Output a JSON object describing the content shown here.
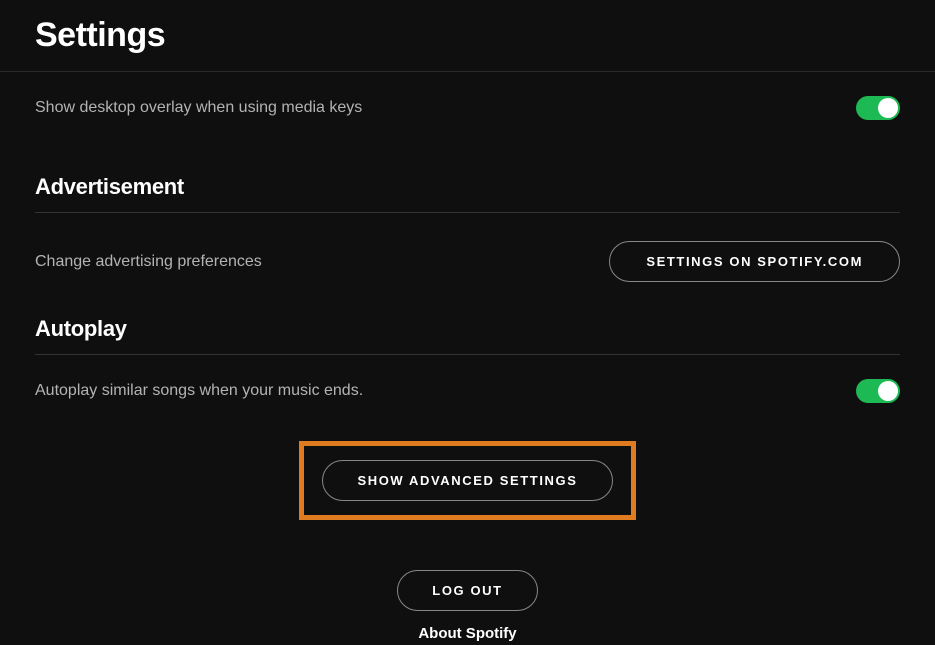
{
  "header": {
    "title": "Settings"
  },
  "overlay": {
    "label": "Show desktop overlay when using media keys",
    "toggled": true
  },
  "advertisement": {
    "heading": "Advertisement",
    "label": "Change advertising preferences",
    "button": "SETTINGS ON SPOTIFY.COM"
  },
  "autoplay": {
    "heading": "Autoplay",
    "label": "Autoplay similar songs when your music ends.",
    "toggled": true
  },
  "buttons": {
    "advanced": "SHOW ADVANCED SETTINGS",
    "logout": "LOG OUT"
  },
  "footer": {
    "about": "About Spotify"
  }
}
